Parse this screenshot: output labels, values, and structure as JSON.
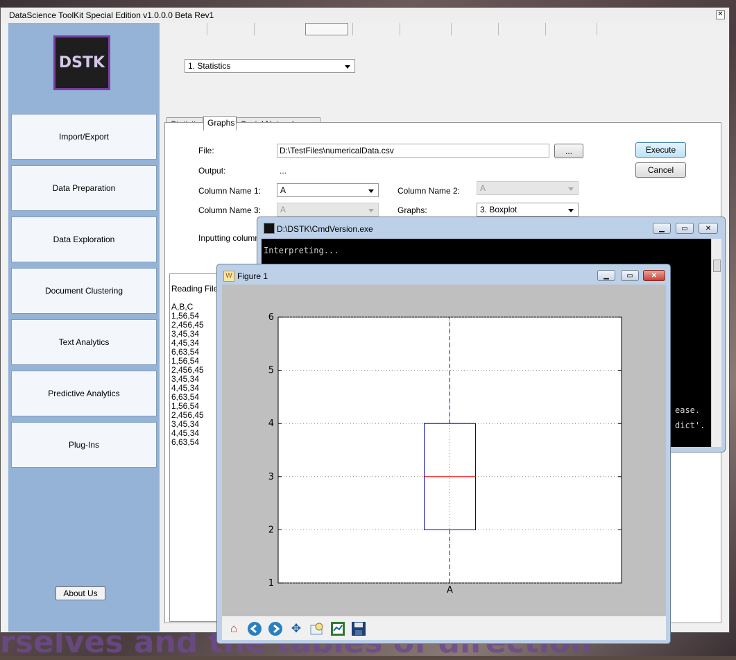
{
  "app": {
    "title": "DataScience ToolKit Special Edition v1.0.0.0 Beta Rev1",
    "logo_text": "DSTK",
    "nav": [
      "Import/Export",
      "Data Preparation",
      "Data Exploration",
      "Document Clustering",
      "Text Analytics",
      "Predictive Analytics",
      "Plug-Ins"
    ],
    "about": "About Us",
    "mode_select": "1. Statistics"
  },
  "tabs": [
    "Statistics",
    "Graphs",
    "Social Network Analysis"
  ],
  "active_tab": "Graphs",
  "form": {
    "file_label": "File:",
    "file_value": "D:\\TestFiles\\numericalData.csv",
    "browse": "...",
    "output_label": "Output:",
    "output_value": "...",
    "col1_label": "Column Name 1:",
    "col1_value": "A",
    "col2_label": "Column Name 2:",
    "col2_value": "A",
    "col3_label": "Column Name 3:",
    "col3_value": "A",
    "graphs_label": "Graphs:",
    "graphs_value": "3. Boxplot",
    "status_text": "Inputting column n",
    "execute": "Execute",
    "cancel": "Cancel"
  },
  "output_log": {
    "header": "Reading File (",
    "lines": [
      "A,B,C",
      "1,56,54",
      "2,456,45",
      "3,45,34",
      "4,45,34",
      "6,63,54",
      "1,56,54",
      "2,456,45",
      "3,45,34",
      "4,45,34",
      "6,63,54",
      "1,56,54",
      "2,456,45",
      "3,45,34",
      "4,45,34",
      "6,63,54"
    ]
  },
  "cmd": {
    "title": "D:\\DSTK\\CmdVersion.exe",
    "line1": "Interpreting...",
    "line2": "ease.",
    "line3": "dict'."
  },
  "figure": {
    "title": "Figure 1",
    "toolbar_icons": [
      "home-icon",
      "back-icon",
      "forward-icon",
      "pan-icon",
      "zoom-icon",
      "subplots-icon",
      "save-icon"
    ]
  },
  "chart_data": {
    "type": "boxplot",
    "categories": [
      "A"
    ],
    "box": {
      "min": 1,
      "q1": 2,
      "median": 3,
      "q3": 4,
      "max": 6
    },
    "yticks": [
      1,
      2,
      3,
      4,
      5,
      6
    ],
    "ylim": [
      1,
      6
    ],
    "grid": true,
    "colors": {
      "box": "#0000aa",
      "median": "#ff0000",
      "whisker": "#0000ff",
      "grid": "#888888"
    }
  }
}
